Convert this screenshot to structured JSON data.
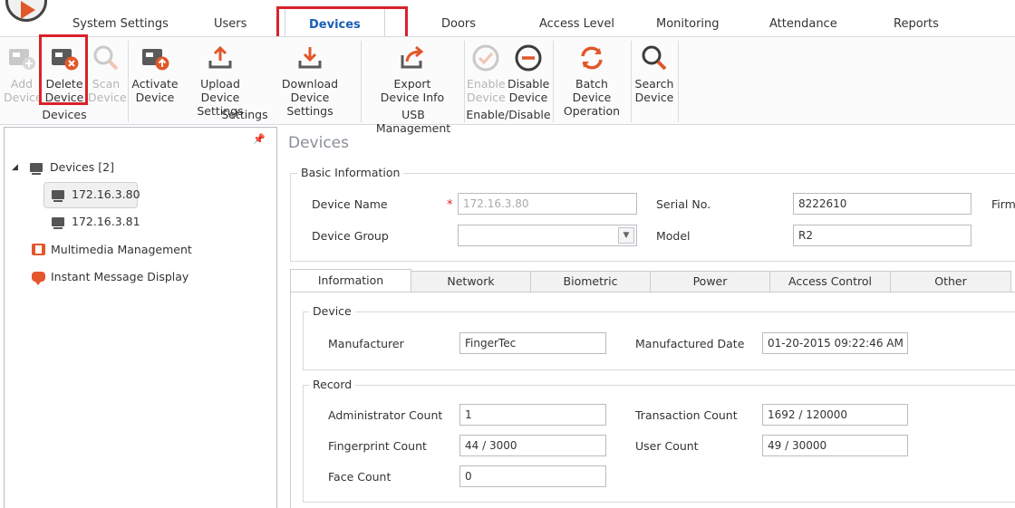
{
  "colors": {
    "accent": "#1a5fb4",
    "highlight": "#d9222a",
    "icon_orange": "#e2572a"
  },
  "tabs": [
    {
      "label": "System Settings"
    },
    {
      "label": "Users"
    },
    {
      "label": "Devices",
      "active": true
    },
    {
      "label": "Doors"
    },
    {
      "label": "Access Level"
    },
    {
      "label": "Monitoring"
    },
    {
      "label": "Attendance"
    },
    {
      "label": "Reports"
    }
  ],
  "ribbon": {
    "buttons": {
      "add_device": {
        "line1": "Add",
        "line2": "Device",
        "icon": "add-device-icon",
        "enabled": false
      },
      "delete_device": {
        "line1": "Delete",
        "line2": "Device",
        "icon": "delete-device-icon",
        "enabled": true
      },
      "scan_device": {
        "line1": "Scan",
        "line2": "Device",
        "icon": "scan-device-icon",
        "enabled": false
      },
      "activate_device": {
        "line1": "Activate",
        "line2": "Device",
        "icon": "activate-device-icon",
        "enabled": true
      },
      "upload_settings": {
        "line1": "Upload Device",
        "line2": "Settings",
        "icon": "upload-icon",
        "enabled": true
      },
      "download_settings": {
        "line1": "Download Device",
        "line2": "Settings",
        "icon": "download-icon",
        "enabled": true
      },
      "export_info": {
        "line1": "Export",
        "line2": "Device Info",
        "icon": "export-icon",
        "enabled": true
      },
      "enable_device": {
        "line1": "Enable",
        "line2": "Device",
        "icon": "check-circle-icon",
        "enabled": false
      },
      "disable_device": {
        "line1": "Disable",
        "line2": "Device",
        "icon": "minus-circle-icon",
        "enabled": true
      },
      "batch_operation": {
        "line1": "Batch Device",
        "line2": "Operation",
        "icon": "refresh-icon",
        "enabled": true
      },
      "search_device": {
        "line1": "Search",
        "line2": "Device",
        "icon": "search-icon",
        "enabled": true
      }
    },
    "groups": {
      "devices": "Devices",
      "settings": "Settings",
      "usb": "USB Management",
      "enable_disable": "Enable/Disable"
    }
  },
  "tree": {
    "root": "Devices [2]",
    "devices": [
      "172.16.3.80",
      "172.16.3.81"
    ],
    "multimedia": "Multimedia Management",
    "instant_message": "Instant Message Display"
  },
  "detail": {
    "title": "Devices",
    "basic_info": {
      "legend": "Basic Information",
      "device_name_label": "Device Name",
      "device_name_value": "172.16.3.80",
      "serial_label": "Serial No.",
      "serial_value": "8222610",
      "firmware_label": "Firm",
      "group_label": "Device Group",
      "group_value": "",
      "model_label": "Model",
      "model_value": "R2"
    },
    "subtabs": [
      "Information",
      "Network",
      "Biometric",
      "Power",
      "Access Control",
      "Other"
    ],
    "device_section": {
      "legend": "Device",
      "manufacturer_label": "Manufacturer",
      "manufacturer_value": "FingerTec",
      "date_label": "Manufactured Date",
      "date_value": "01-20-2015 09:22:46 AM"
    },
    "record_section": {
      "legend": "Record",
      "admin_label": "Administrator Count",
      "admin_value": "1",
      "transaction_label": "Transaction Count",
      "transaction_value": "1692 / 120000",
      "fingerprint_label": "Fingerprint Count",
      "fingerprint_value": "44 / 3000",
      "user_label": "User Count",
      "user_value": "49 / 30000",
      "face_label": "Face Count",
      "face_value": "0"
    }
  }
}
